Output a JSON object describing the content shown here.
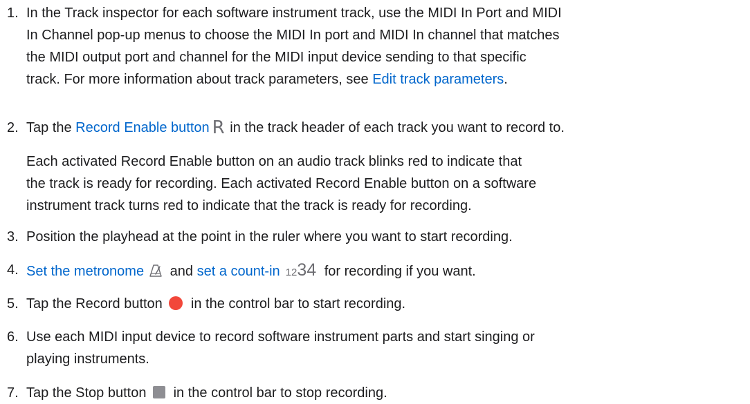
{
  "steps": [
    {
      "number": "1.",
      "lines": [
        "In the Track inspector for each software instrument track, use the MIDI In Port and MIDI",
        "In Channel pop-up menus to choose the MIDI In port and MIDI In channel that matches",
        "the MIDI output port and channel for the MIDI input device sending to that specific"
      ],
      "last_line_prefix": "track. For more information about track parameters, see ",
      "link": "Edit track parameters",
      "last_line_suffix": "."
    },
    {
      "number": "2.",
      "prefix": "Tap the ",
      "link": "Record Enable button",
      "icon": "R",
      "icon_name": "record-enable-icon",
      "suffix": " in the track header of each track you want to record to.",
      "note_lines": [
        "Each activated Record Enable button on an audio track blinks red to indicate that",
        "the track is ready for recording. Each activated Record Enable button on a software",
        "instrument track turns red to indicate that the track is ready for recording."
      ]
    },
    {
      "number": "3.",
      "text": "Position the playhead at the point in the ruler where you want to start recording."
    },
    {
      "number": "4.",
      "link1": "Set the metronome",
      "icon1_name": "metronome-icon",
      "middle": " and ",
      "link2": "set a count-in",
      "countin_small": "12",
      "countin_big": "34",
      "suffix": " for recording if you want."
    },
    {
      "number": "5.",
      "prefix": "Tap the Record button ",
      "icon_name": "record-button-icon",
      "icon_color": "#f2473a",
      "suffix": " in the control bar to start recording."
    },
    {
      "number": "6.",
      "lines": [
        "Use each MIDI input device to record software instrument parts and start singing or",
        "playing instruments."
      ]
    },
    {
      "number": "7.",
      "prefix": "Tap the Stop button ",
      "icon_name": "stop-button-icon",
      "icon_color": "#8e8e93",
      "suffix": " in the control bar to stop recording."
    }
  ],
  "colors": {
    "text": "#1d1d1f",
    "link": "#0066cc",
    "icon_gray": "#6e6e73"
  }
}
